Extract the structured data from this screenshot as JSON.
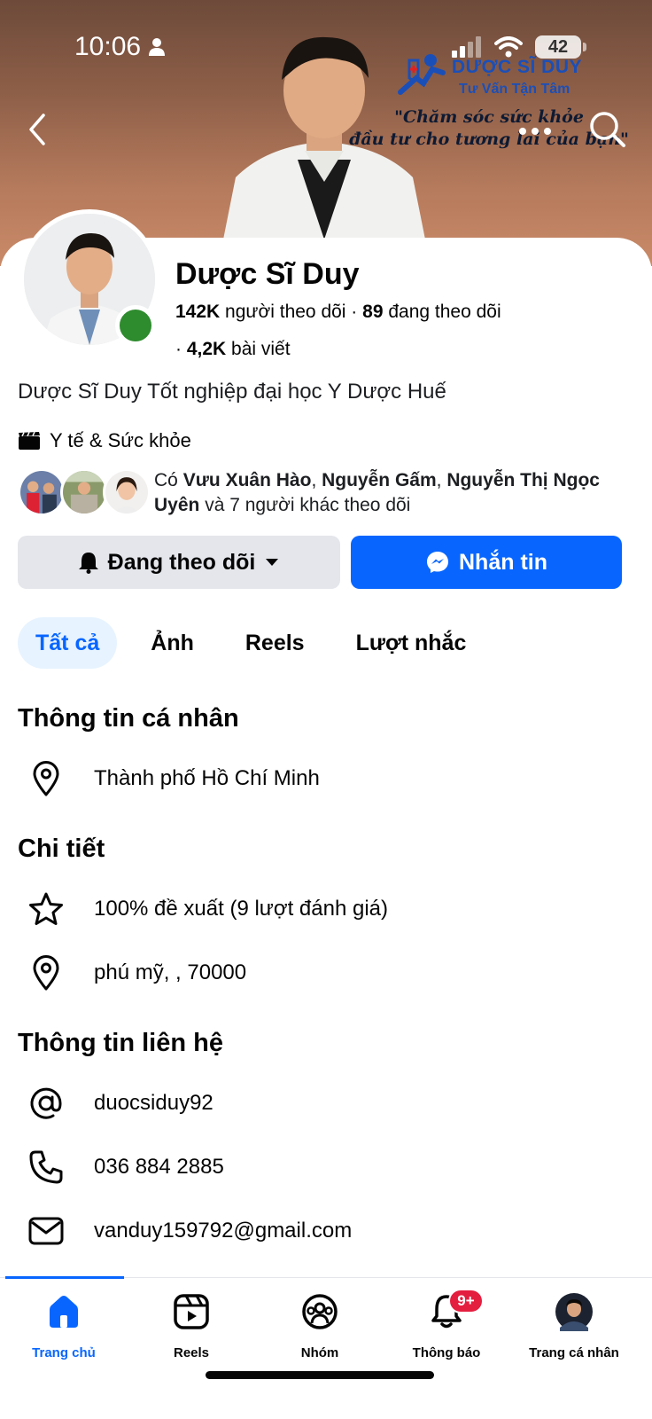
{
  "status_bar": {
    "time": "10:06",
    "battery": "42"
  },
  "cover": {
    "brand_name": "DƯỢC SĨ DUY",
    "brand_tagline": "Tư Vấn Tận Tâm",
    "slogan_line1": "\"Chăm sóc sức khỏe",
    "slogan_line2": "đầu tư cho tương lai của bạn\""
  },
  "profile": {
    "name": "Dược Sĩ Duy",
    "followers_count": "142K",
    "followers_label": "người theo dõi",
    "following_count": "89",
    "following_label": "đang theo dõi",
    "posts_count": "4,2K",
    "posts_label": "bài viết",
    "bio": "Dược Sĩ Duy Tốt nghiệp đại học Y Dược Huế",
    "category": "Y tế & Sức khỏe",
    "mutual": {
      "prefix": "Có",
      "name1": "Vưu Xuân Hào",
      "name2": "Nguyễn Gấm",
      "name3": "Nguyễn Thị Ngọc Uyên",
      "suffix": "và 7 người khác theo dõi"
    }
  },
  "actions": {
    "following_button": "Đang theo dõi",
    "message_button": "Nhắn tin"
  },
  "tabs": [
    {
      "label": "Tất cả",
      "active": true
    },
    {
      "label": "Ảnh",
      "active": false
    },
    {
      "label": "Reels",
      "active": false
    },
    {
      "label": "Lượt nhắc",
      "active": false
    }
  ],
  "personal_info": {
    "title": "Thông tin cá nhân",
    "location": "Thành phố Hồ Chí Minh"
  },
  "details": {
    "title": "Chi tiết",
    "rating": "100% đề xuất (9 lượt đánh giá)",
    "address": "phú mỹ, , 70000"
  },
  "contact": {
    "title": "Thông tin liên hệ",
    "username": "duocsiduy92",
    "phone": "036 884 2885",
    "email": "vanduy159792@gmail.com"
  },
  "bottom_nav": [
    {
      "label": "Trang chủ",
      "icon": "home-icon",
      "active": true
    },
    {
      "label": "Reels",
      "icon": "reels-icon",
      "active": false
    },
    {
      "label": "Nhóm",
      "icon": "groups-icon",
      "active": false
    },
    {
      "label": "Thông báo",
      "icon": "bell-icon",
      "active": false,
      "badge": "9+"
    },
    {
      "label": "Trang cá nhân",
      "icon": "profile-avatar",
      "active": false
    }
  ],
  "colors": {
    "accent": "#0866ff",
    "online": "#2e8b2e",
    "badge": "#e41e3f",
    "button_gray": "#e4e6eb"
  }
}
